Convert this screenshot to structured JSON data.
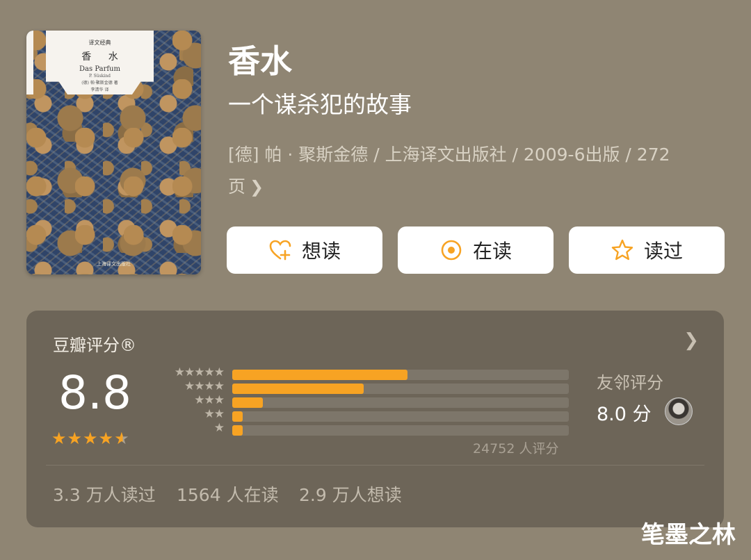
{
  "book": {
    "title": "香水",
    "subtitle": "一个谋杀犯的故事",
    "meta_line1": "[德] 帕 · 聚斯金德 / 上海译文出版社 / 2009-6出版 / 272",
    "meta_line2": "页",
    "cover": {
      "series": "译文经典",
      "title": "香 水",
      "original_title": "Das Parfum",
      "author_latin": "P. Süskind",
      "author_cn": "(德) 帕·聚斯金德 著",
      "translator": "李清华 译",
      "publisher": "上海译文出版社"
    }
  },
  "actions": {
    "want": "想读",
    "reading": "在读",
    "read": "读过"
  },
  "rating": {
    "title": "豆瓣评分®",
    "score": "8.8",
    "stars_value": 4.5,
    "distribution": [
      {
        "stars": "★★★★★",
        "fraction": 0.52
      },
      {
        "stars": "★★★★",
        "fraction": 0.39
      },
      {
        "stars": "★★★",
        "fraction": 0.09
      },
      {
        "stars": "★★",
        "fraction": 0.03
      },
      {
        "stars": "★",
        "fraction": 0.03
      }
    ],
    "count": "24752 人评分",
    "friend_label": "友邻评分",
    "friend_score": "8.0 分"
  },
  "stats": {
    "read": "3.3 万人读过",
    "reading": "1564 人在读",
    "want": "2.9 万人想读"
  },
  "watermark": "笔墨之林",
  "colors": {
    "background": "#8f8573",
    "card": "#6d6558",
    "accent": "#f7a323",
    "button": "#ffffff"
  },
  "icons": {
    "want": "heart-plus-icon",
    "reading": "target-icon",
    "read": "star-outline-icon"
  }
}
